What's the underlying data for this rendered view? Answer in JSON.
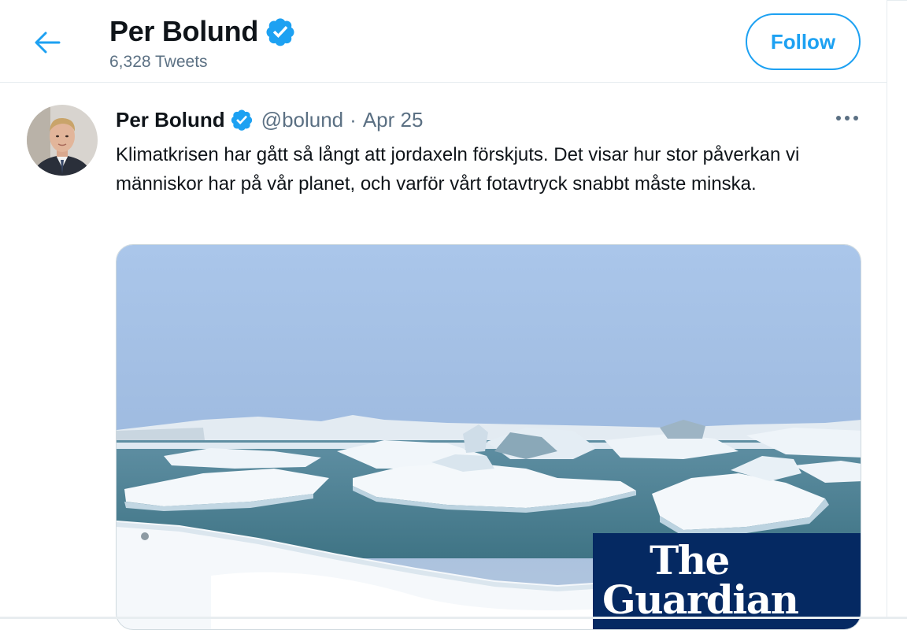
{
  "header": {
    "name": "Per Bolund",
    "tweet_count": "6,328 Tweets",
    "follow_label": "Follow"
  },
  "tweet": {
    "author_name": "Per Bolund",
    "handle": "@bolund",
    "separator": "·",
    "date": "Apr 25",
    "text": "Klimatkrisen har gått så långt att jordaxeln förskjuts. Det visar hur stor påverkan vi människor har på vår planet, och varför vårt fotavtryck snabbt måste minska.",
    "media": {
      "logo_line1": "The",
      "logo_line2": "Guardian"
    }
  },
  "colors": {
    "accent": "#1da1f2",
    "secondary_text": "#5b7083",
    "guardian_blue": "#052962"
  },
  "icons": {
    "back": "arrow-left-icon",
    "verified": "verified-badge-icon",
    "more": "more-horizontal-icon"
  }
}
